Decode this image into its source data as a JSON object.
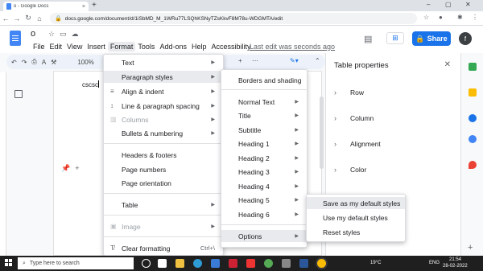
{
  "browser": {
    "tab_title": "o - Google Docs",
    "tab_close": "×",
    "new_tab": "+",
    "url": "docs.google.com/document/d/1iSbMD_M_1WRu77LSQhKSNyTZsKkvF8M78u-WDGMTA/edit",
    "win_min": "–",
    "win_max": "▢",
    "win_close": "✕"
  },
  "docs": {
    "title": "o",
    "menus": [
      "File",
      "Edit",
      "View",
      "Insert",
      "Format",
      "Tools",
      "Add-ons",
      "Help",
      "Accessibility"
    ],
    "last_edit": "Last edit was seconds ago",
    "share_label": "Share",
    "avatar_letter": "f",
    "zoom": "100%",
    "doc_text": "cscsc",
    "toolbar_plus": "+",
    "toolbar_more": "⋯"
  },
  "format_menu": {
    "items": [
      {
        "label": "Text"
      },
      {
        "label": "Paragraph styles"
      },
      {
        "label": "Align & indent"
      },
      {
        "label": "Line & paragraph spacing"
      },
      {
        "label": "Columns"
      },
      {
        "label": "Bullets & numbering"
      },
      {
        "label": "Headers & footers"
      },
      {
        "label": "Page numbers"
      },
      {
        "label": "Page orientation"
      },
      {
        "label": "Table"
      },
      {
        "label": "Image"
      },
      {
        "label": "Clear formatting",
        "shortcut": "Ctrl+\\"
      }
    ]
  },
  "paragraph_menu": {
    "borders": "Borders and shading",
    "styles": [
      "Normal Text",
      "Title",
      "Subtitle",
      "Heading 1",
      "Heading 2",
      "Heading 3",
      "Heading 4",
      "Heading 5",
      "Heading 6"
    ],
    "options": "Options"
  },
  "options_menu": {
    "items": [
      "Save as my default styles",
      "Use my default styles",
      "Reset styles"
    ]
  },
  "table_properties": {
    "title": "Table properties",
    "sections": [
      "Row",
      "Column",
      "Alignment",
      "Color"
    ]
  },
  "taskbar": {
    "search_placeholder": "Type here to search",
    "weather": "19°C",
    "lang": "ENG",
    "time": "21:54",
    "date": "28-02-2022"
  },
  "colors": {
    "accent": "#1a73e8",
    "docs_blue": "#4285f4"
  }
}
